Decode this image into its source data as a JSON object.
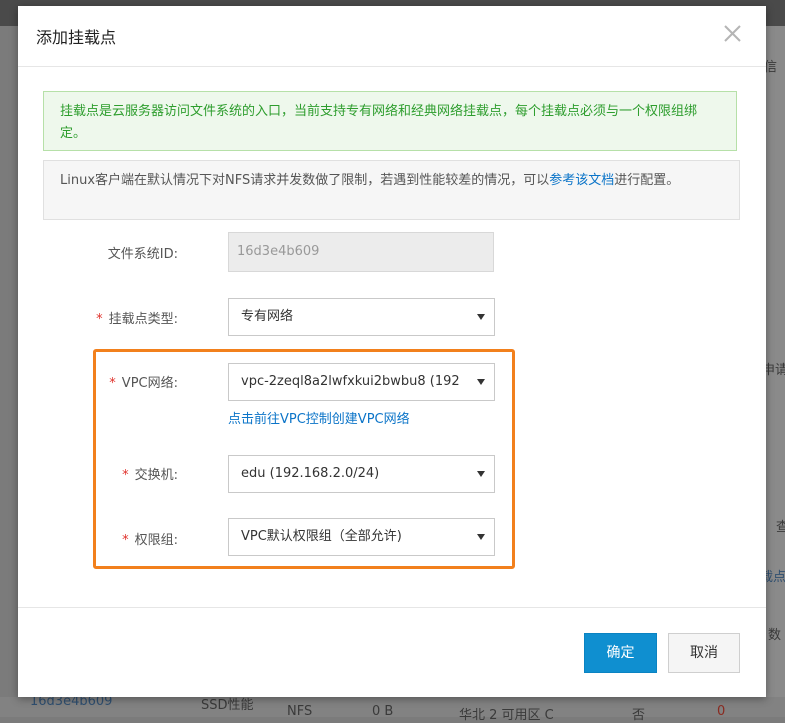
{
  "background": {
    "row": {
      "id": "16d3e4b609",
      "storage_type": "SSD性能",
      "protocol": "NFS",
      "size": "0 B",
      "region": "华北 2 可用区 C",
      "encrypted": "否",
      "count": "0"
    },
    "right_fragments": [
      "信",
      "申请",
      "查",
      "载点",
      "数"
    ]
  },
  "dialog": {
    "title": "添加挂载点",
    "notice_primary": "挂载点是云服务器访问文件系统的入口，当前支持专有网络和经典网络挂载点，每个挂载点必须与一个权限组绑定。",
    "notice_secondary": {
      "text_before": "Linux客户端在默认情况下对NFS请求并发数做了限制，若遇到性能较差的情况，可以",
      "link_text": "参考该文档",
      "text_after": "进行配置。"
    },
    "fields": {
      "filesystem_id": {
        "label": "文件系统ID:",
        "value": "16d3e4b609"
      },
      "mount_type": {
        "label": "挂载点类型:",
        "value": "专有网络",
        "required_mark": "*"
      },
      "vpc": {
        "label": "VPC网络:",
        "value": "vpc-2zeql8a2lwfxkui2bwbu8 (192.",
        "required_mark": "*"
      },
      "vpc_link": "点击前往VPC控制创建VPC网络",
      "switch": {
        "label": "交换机:",
        "value": "edu (192.168.2.0/24)",
        "required_mark": "*"
      },
      "permission_group": {
        "label": "权限组:",
        "value": "VPC默认权限组（全部允许)",
        "required_mark": "*"
      }
    },
    "buttons": {
      "confirm": "确定",
      "cancel": "取消"
    }
  },
  "colors": {
    "primary_button": "#0f8fd0",
    "highlight": "#f2801c",
    "link": "#0b74c8",
    "notice_green_text": "#2d9d2d",
    "required_mark": "#e0302a"
  }
}
